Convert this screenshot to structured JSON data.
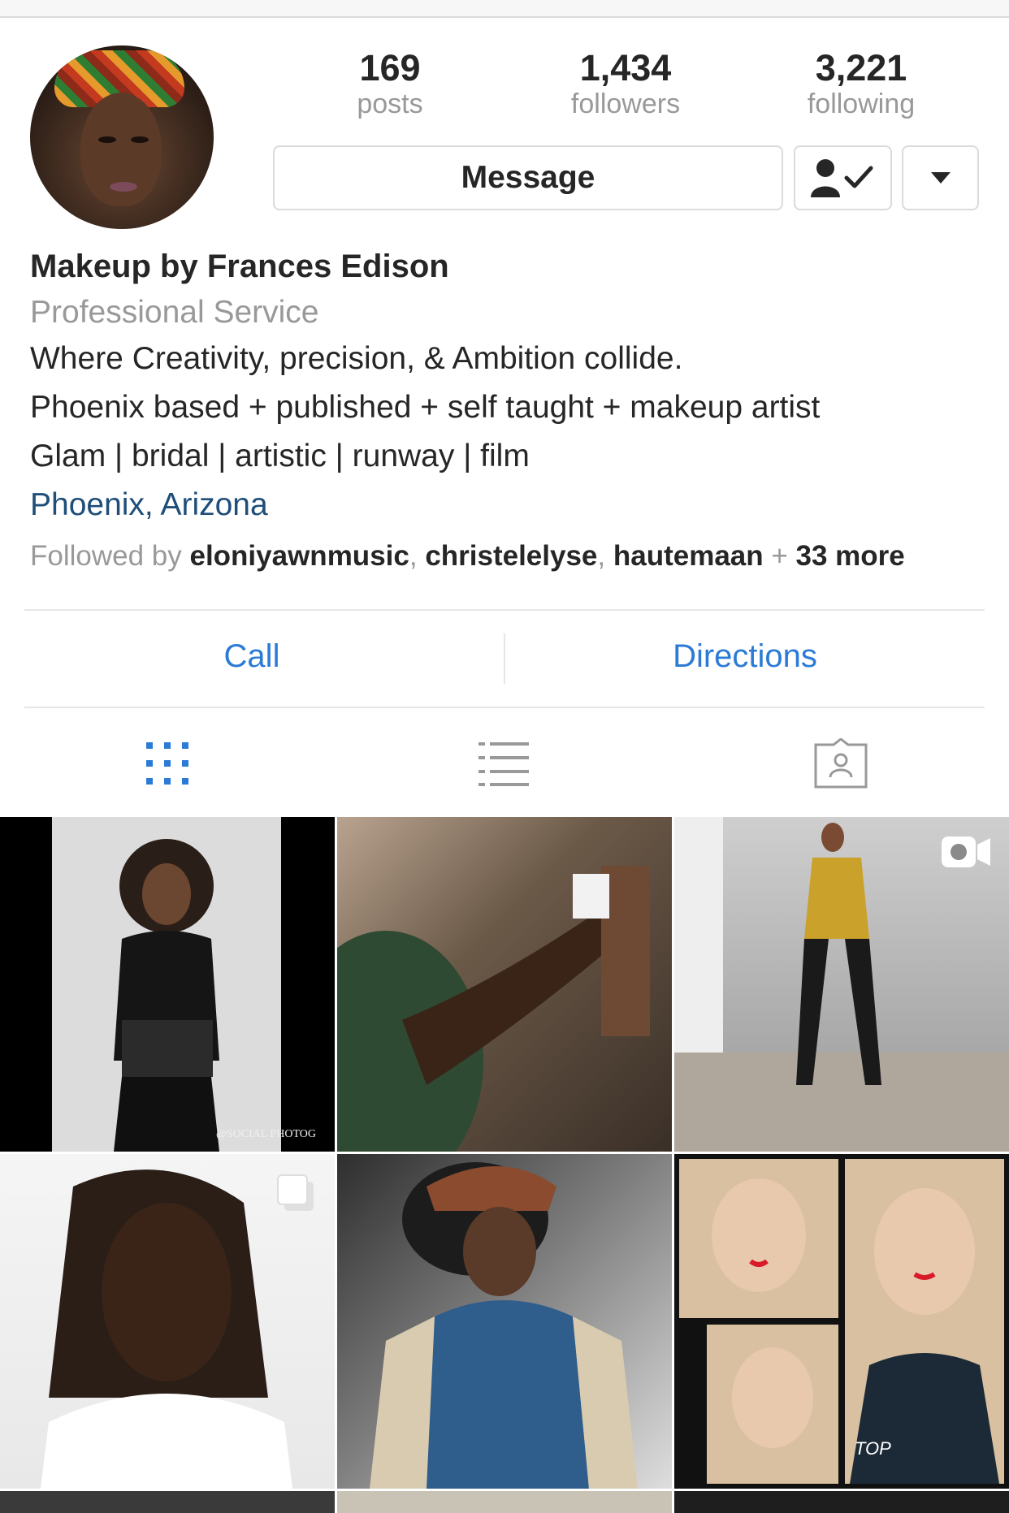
{
  "profile": {
    "stats": {
      "posts": {
        "num": "169",
        "label": "posts"
      },
      "followers": {
        "num": "1,434",
        "label": "followers"
      },
      "following": {
        "num": "3,221",
        "label": "following"
      }
    },
    "message_label": "Message",
    "name": "Makeup by Frances Edison",
    "category": "Professional Service",
    "bio": [
      "Where Creativity, precision, & Ambition collide.",
      "Phoenix based + published + self taught + makeup artist",
      "Glam | bridal | artistic | runway | film"
    ],
    "location": "Phoenix, Arizona",
    "followed_by": {
      "prefix": "Followed by ",
      "users": [
        "eloniyawnmusic",
        "christelelyse",
        "hautemaan"
      ],
      "sep": ", ",
      "plus": " + ",
      "more": "33 more"
    }
  },
  "actions": {
    "call": "Call",
    "directions": "Directions"
  },
  "tabs": [
    {
      "name": "grid-icon",
      "active": true
    },
    {
      "name": "list-icon",
      "active": false
    },
    {
      "name": "tagged-icon",
      "active": false
    }
  ],
  "tile_texts": {
    "watermark": "@SOCIAL PHOTOG",
    "top": "TOP"
  },
  "colors": {
    "accent": "#2b7bd6",
    "location": "#1f4e79",
    "muted": "#999999",
    "text": "#262626"
  }
}
